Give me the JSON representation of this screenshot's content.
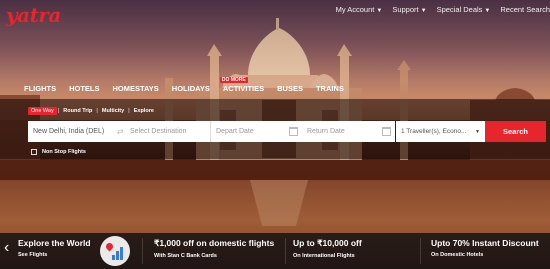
{
  "brand": {
    "logo_text": "yatra",
    "accent_color": "#e8242c"
  },
  "top_nav": [
    {
      "label": "My Account",
      "has_dropdown": true
    },
    {
      "label": "Support",
      "has_dropdown": true
    },
    {
      "label": "Special Deals",
      "has_dropdown": true
    },
    {
      "label": "Recent Search",
      "has_dropdown": false
    }
  ],
  "product_tabs": [
    {
      "label": "FLIGHTS",
      "badge": ""
    },
    {
      "label": "HOTELS",
      "badge": ""
    },
    {
      "label": "HOMESTAYS",
      "badge": ""
    },
    {
      "label": "HOLIDAYS",
      "badge": ""
    },
    {
      "label": "ACTIVITIES",
      "badge": "DO MORE"
    },
    {
      "label": "BUSES",
      "badge": ""
    },
    {
      "label": "TRAINS",
      "badge": ""
    }
  ],
  "trip_types": [
    {
      "label": "One Way",
      "selected": true
    },
    {
      "label": "Round Trip",
      "selected": false
    },
    {
      "label": "Multicity",
      "selected": false
    },
    {
      "label": "Explore",
      "selected": false
    }
  ],
  "search_form": {
    "from_value": "New Delhi, India (DEL)",
    "to_placeholder": "Select Destination",
    "depart_placeholder": "Depart Date",
    "return_placeholder": "Return Date",
    "travellers_value": "1 Traveller(s), Econo...",
    "search_label": "Search",
    "non_stop_label": "Non Stop Flights",
    "non_stop_checked": false
  },
  "offers": [
    {
      "title": "Explore the World",
      "subtitle": "See Flights"
    },
    {
      "title": "₹1,000 off on domestic flights",
      "subtitle": "With Stan C Bank Cards"
    },
    {
      "title": "Up to ₹10,000 off",
      "subtitle": "On International Flights"
    },
    {
      "title": "Upto 70% Instant Discount",
      "subtitle": "On Domestic Hotels"
    }
  ]
}
